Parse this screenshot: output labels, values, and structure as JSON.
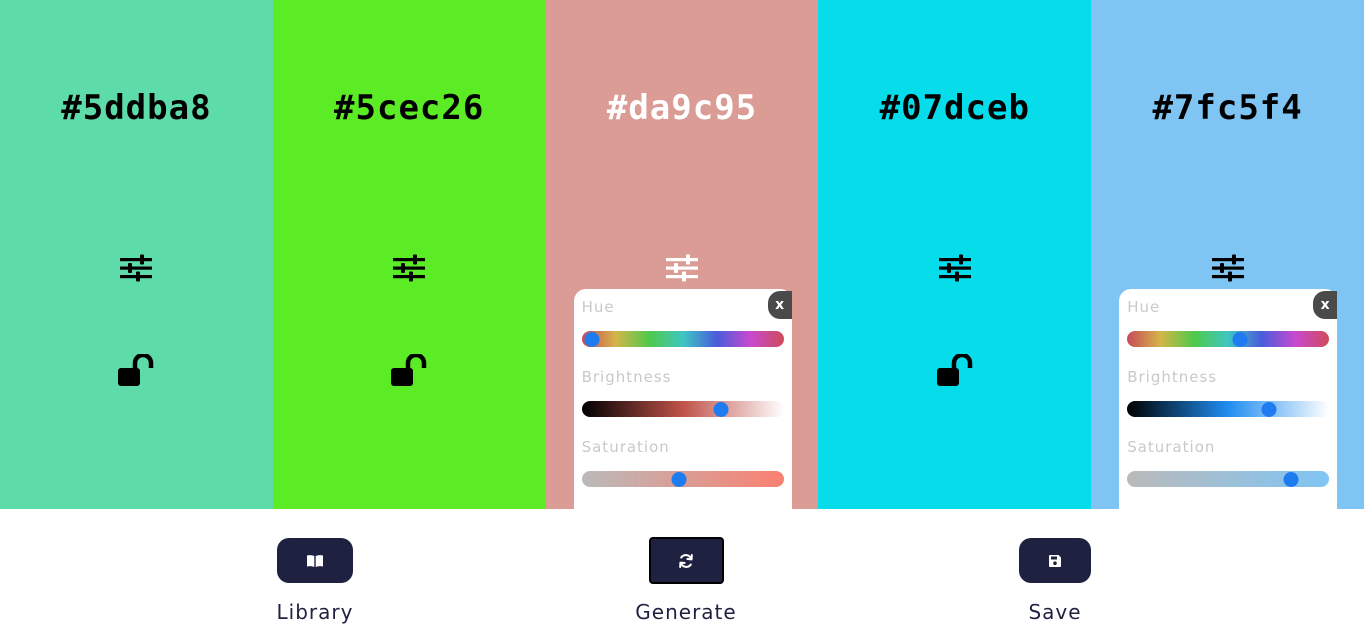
{
  "palette": {
    "swatches": [
      {
        "hex": "#5ddba8",
        "text_color": "#000000",
        "lock": "unlocked",
        "panel_open": false
      },
      {
        "hex": "#5cec26",
        "text_color": "#000000",
        "lock": "unlocked",
        "panel_open": false
      },
      {
        "hex": "#da9c95",
        "text_color": "#ffffff",
        "lock": "unlocked",
        "panel_open": true,
        "panel": {
          "hue_label": "Hue",
          "brightness_label": "Brightness",
          "saturation_label": "Saturation",
          "close_label": "x",
          "hue_value": 0.05,
          "brightness_value": 0.69,
          "saturation_value": 0.48,
          "brightness_color": "#c0534a",
          "saturation_color": "#fa8070"
        }
      },
      {
        "hex": "#07dceb",
        "text_color": "#000000",
        "lock": "unlocked",
        "panel_open": false
      },
      {
        "hex": "#7fc5f4",
        "text_color": "#000000",
        "lock": "unlocked",
        "panel_open": true,
        "panel": {
          "hue_label": "Hue",
          "brightness_label": "Brightness",
          "saturation_label": "Saturation",
          "close_label": "x",
          "hue_value": 0.56,
          "brightness_value": 0.7,
          "saturation_value": 0.81,
          "brightness_color": "#1f8df0",
          "saturation_color": "#7fc5f4"
        }
      }
    ]
  },
  "actions": {
    "library_label": "Library",
    "generate_label": "Generate",
    "save_label": "Save",
    "button_color": "#1f2141"
  },
  "icons": {
    "adjust": "sliders-icon",
    "lock": "unlocked-padlock-icon",
    "library": "book-icon",
    "generate": "refresh-icon",
    "save": "floppy-disk-icon"
  }
}
